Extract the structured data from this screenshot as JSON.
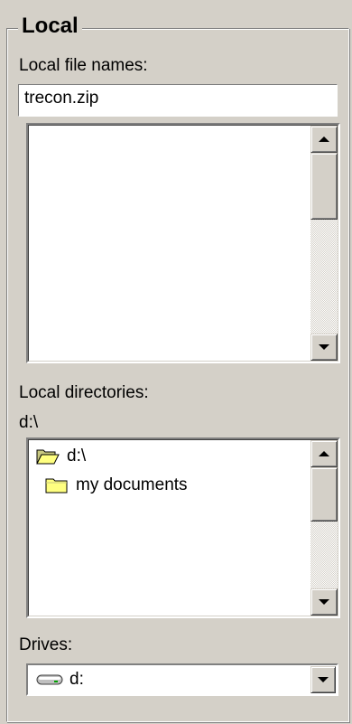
{
  "group": {
    "title": "Local"
  },
  "file_names": {
    "label": "Local file names:",
    "value": "trecon.zip",
    "items": []
  },
  "directories": {
    "label": "Local directories:",
    "current_path": "d:\\",
    "items": [
      {
        "label": "d:\\",
        "icon": "open-folder-icon"
      },
      {
        "label": "my documents",
        "icon": "folder-icon"
      }
    ]
  },
  "drives": {
    "label": "Drives:",
    "selected": "d:",
    "icon": "drive-icon"
  },
  "colors": {
    "face": "#d4d0c8",
    "folder": "#ffff80"
  }
}
